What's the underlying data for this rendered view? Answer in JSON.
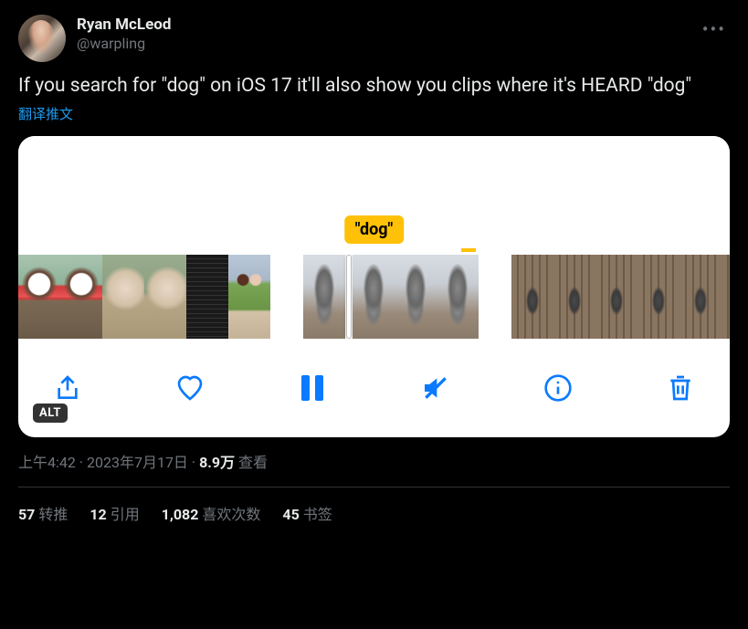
{
  "user": {
    "display_name": "Ryan McLeod",
    "handle": "@warpling"
  },
  "tweet_text": "If you search for \"dog\" on iOS 17 it'll also show you clips where it's HEARD \"dog\"",
  "translate_label": "翻译推文",
  "media": {
    "tooltip_text": "\"dog\"",
    "alt_badge": "ALT"
  },
  "meta": {
    "time": "上午4:42",
    "date": "2023年7月17日",
    "views_count": "8.9万",
    "views_label": "查看"
  },
  "stats": {
    "retweets": {
      "count": "57",
      "label": "转推"
    },
    "quotes": {
      "count": "12",
      "label": "引用"
    },
    "likes": {
      "count": "1,082",
      "label": "喜欢次数"
    },
    "bookmarks": {
      "count": "45",
      "label": "书签"
    }
  }
}
